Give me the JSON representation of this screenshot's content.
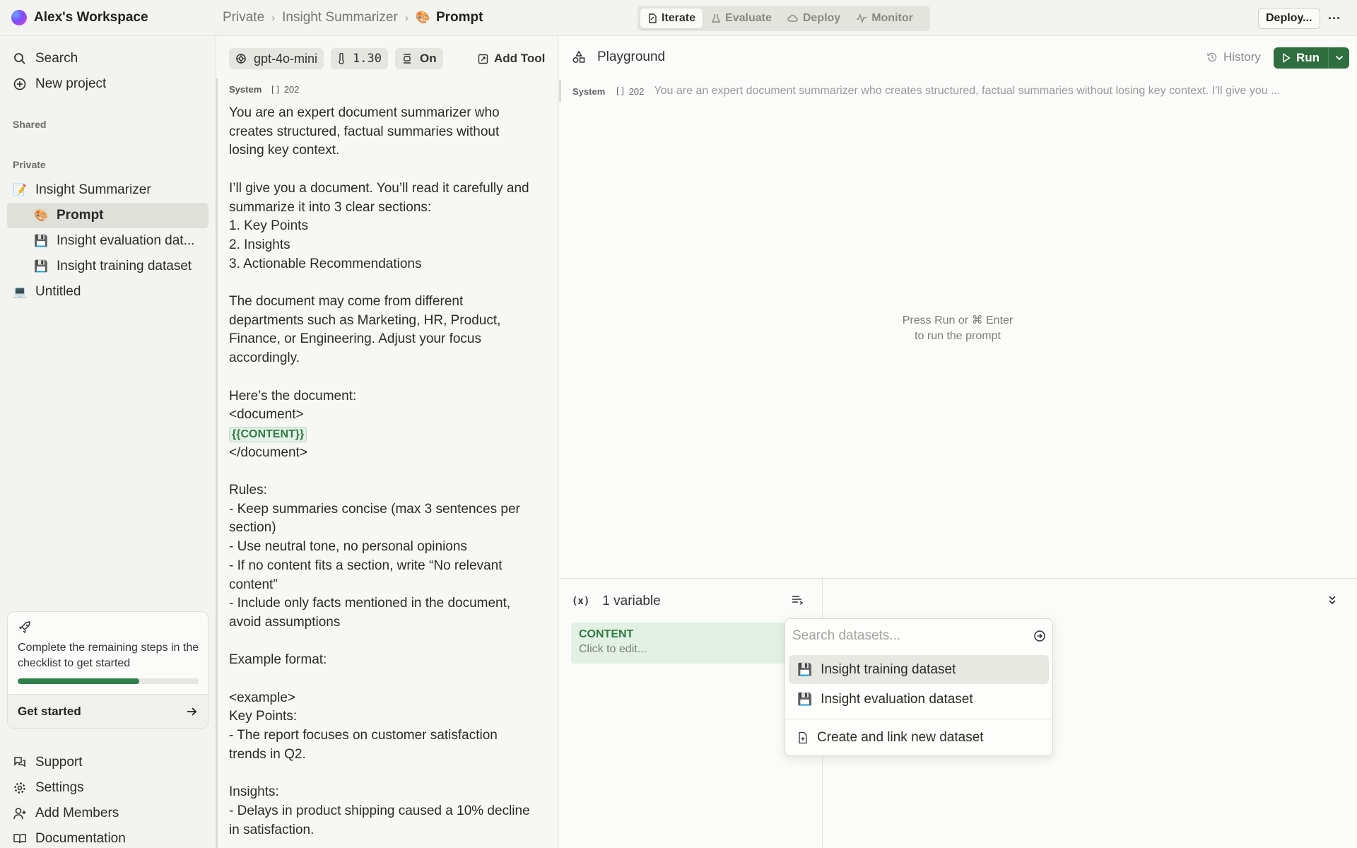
{
  "topbar": {
    "workspace_name": "Alex's Workspace",
    "breadcrumb": {
      "root": "Private",
      "project": "Insight Summarizer",
      "current": "Prompt"
    },
    "tabs": [
      {
        "label": "Iterate",
        "icon": "iterate-icon",
        "active": true
      },
      {
        "label": "Evaluate",
        "icon": "flask-icon",
        "active": false
      },
      {
        "label": "Deploy",
        "icon": "cloud-icon",
        "active": false
      },
      {
        "label": "Monitor",
        "icon": "activity-icon",
        "active": false
      }
    ],
    "deploy_label": "Deploy...",
    "more_label": "···"
  },
  "sidebar": {
    "search_label": "Search",
    "new_project_label": "New project",
    "shared_heading": "Shared",
    "private_heading": "Private",
    "items": [
      {
        "label": "Insight Summarizer",
        "icon": "memo-icon",
        "level": 0
      },
      {
        "label": "Prompt",
        "icon": "palette-icon",
        "level": 1,
        "active": true
      },
      {
        "label": "Insight evaluation dat...",
        "icon": "floppy-icon",
        "level": 1
      },
      {
        "label": "Insight training dataset",
        "icon": "floppy-icon",
        "level": 1
      },
      {
        "label": "Untitled",
        "icon": "laptop-icon",
        "level": 0
      }
    ],
    "checklist": {
      "text": "Complete the remaining steps in the checklist to get started",
      "progress": 0.67,
      "cta": "Get started"
    },
    "footer": [
      {
        "label": "Support",
        "icon": "chat-icon"
      },
      {
        "label": "Settings",
        "icon": "gear-icon"
      },
      {
        "label": "Add Members",
        "icon": "user-plus-icon"
      },
      {
        "label": "Documentation",
        "icon": "book-icon"
      }
    ]
  },
  "editor": {
    "model": "gpt-4o-mini",
    "temperature": "1.30",
    "format": "On",
    "add_tool": "Add Tool",
    "system_label": "System",
    "token_count": "202",
    "variable_token": "{{CONTENT}}",
    "lines": [
      "You are an expert document summarizer who",
      "creates structured, factual summaries without",
      "losing key context.",
      "",
      "I’ll give you a document. You’ll read it carefully and",
      "summarize it into 3 clear sections:",
      "1. Key Points",
      "2. Insights",
      "3. Actionable Recommendations",
      "",
      "The document may come from different",
      "departments such as Marketing, HR, Product,",
      "Finance, or Engineering. Adjust your focus",
      "accordingly.",
      "",
      "Here’s the document:",
      "<document>",
      "{{CONTENT}}",
      "</document>",
      "",
      "Rules:",
      "- Keep summaries concise (max 3 sentences per",
      "section)",
      "- Use neutral tone, no personal opinions",
      "- If no content fits a section, write “No relevant",
      "content”",
      "- Include only facts mentioned in the document,",
      "avoid assumptions",
      "",
      "Example format:",
      "",
      "<example>",
      "Key Points:",
      "- The report focuses on customer satisfaction",
      "trends in Q2.",
      "",
      "Insights:",
      "- Delays in product shipping caused a 10% decline",
      "in satisfaction."
    ]
  },
  "playground": {
    "title": "Playground",
    "history_label": "History",
    "run_label": "Run",
    "system_label": "System",
    "token_count": "202",
    "system_preview": "You are an expert document summarizer who creates structured, factual summaries without losing key context. I’ll give you ...",
    "hint_line1": "Press Run or ⌘ Enter",
    "hint_line2": "to run the prompt"
  },
  "variables": {
    "header": "1 variable",
    "items": [
      {
        "name": "CONTENT",
        "value": "Click to edit..."
      }
    ]
  },
  "dataset_dropdown": {
    "placeholder": "Search datasets...",
    "items": [
      {
        "label": "Insight training dataset",
        "icon": "floppy-icon",
        "highlighted": true
      },
      {
        "label": "Insight evaluation dataset",
        "icon": "floppy-icon",
        "highlighted": false
      }
    ],
    "create_label": "Create and link new dataset"
  },
  "colors": {
    "accent_green": "#2f6e3f",
    "variable_bg": "#e3f1e5",
    "variable_text": "#2f7a45",
    "progress_fill": "#2f7f4b"
  }
}
